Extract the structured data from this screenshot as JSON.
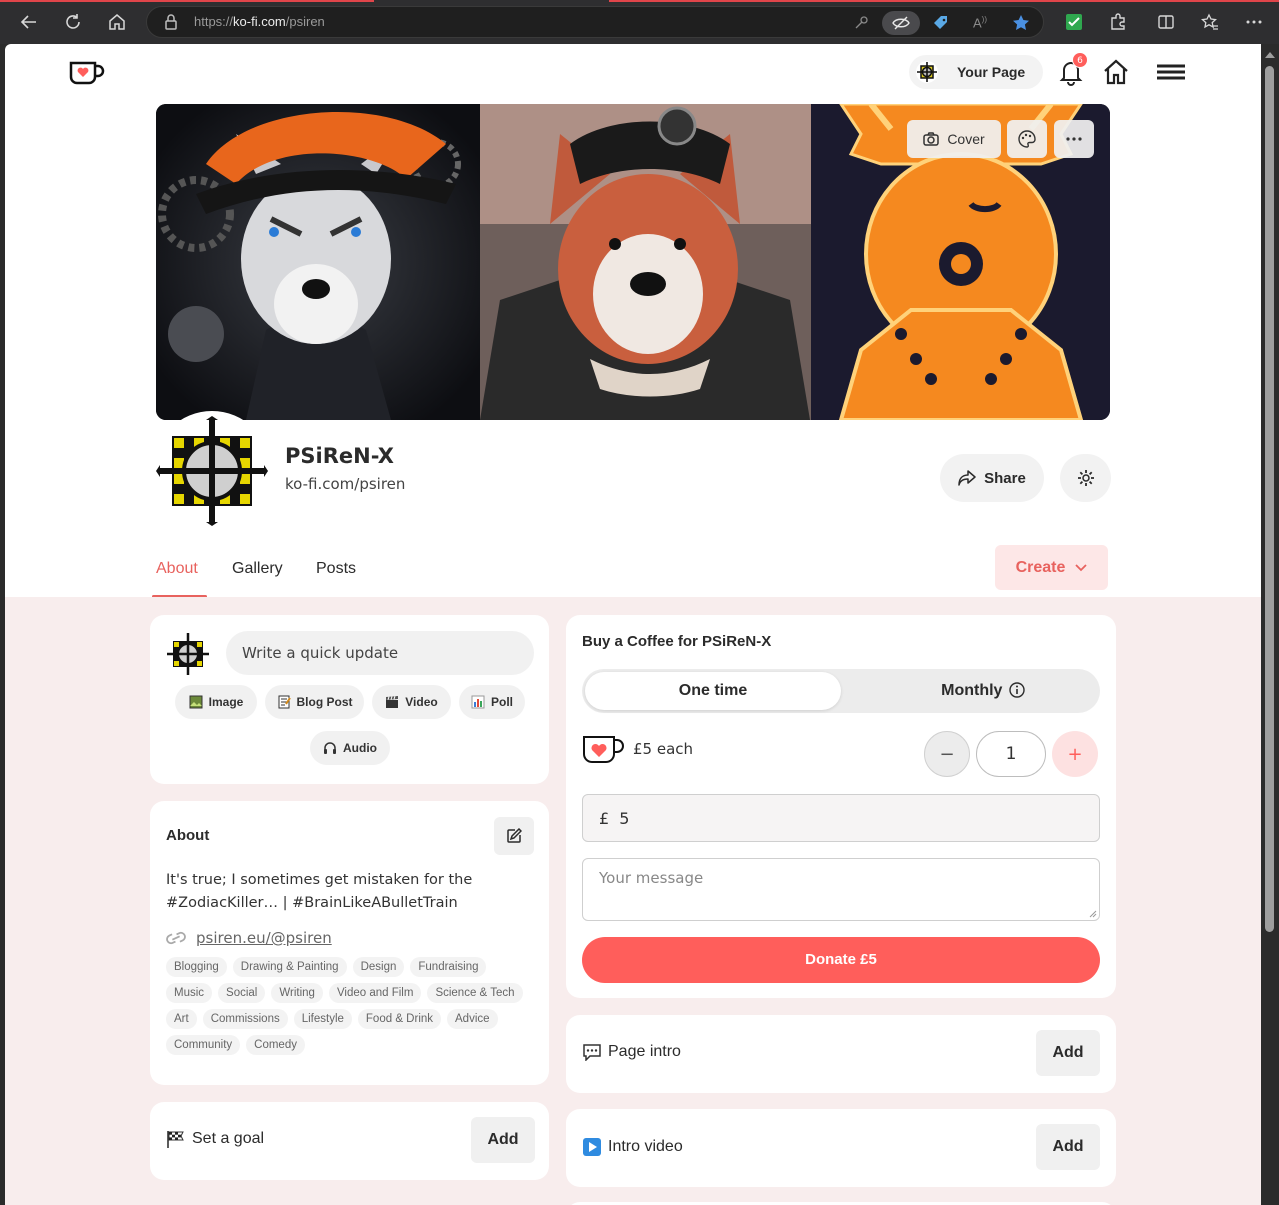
{
  "browser": {
    "url_prefix": "https://",
    "url_host": "ko-fi.com",
    "url_path": "/psiren"
  },
  "nav": {
    "your_page_label": "Your Page",
    "notification_count": "6"
  },
  "cover": {
    "cover_button_label": "Cover"
  },
  "profile": {
    "name": "PSiReN-X",
    "url": "ko-fi.com/psiren",
    "share_label": "Share"
  },
  "tabs": {
    "about": "About",
    "gallery": "Gallery",
    "posts": "Posts",
    "create_label": "Create"
  },
  "composer": {
    "placeholder": "Write a quick update",
    "actions": [
      "Image",
      "Blog Post",
      "Video",
      "Poll",
      "Audio"
    ]
  },
  "about": {
    "title": "About",
    "text": "It's true; I sometimes get mistaken for the #ZodiacKiller… | #BrainLikeABulletTrain",
    "link": "psiren.eu/@psiren",
    "tags": [
      "Blogging",
      "Drawing & Painting",
      "Design",
      "Fundraising",
      "Music",
      "Social",
      "Writing",
      "Video and Film",
      "Science & Tech",
      "Art",
      "Commissions",
      "Lifestyle",
      "Food & Drink",
      "Advice",
      "Community",
      "Comedy"
    ]
  },
  "goal": {
    "label": "Set a goal",
    "add_label": "Add"
  },
  "coffee": {
    "title": "Buy a Coffee for PSiReN-X",
    "one_time": "One time",
    "monthly": "Monthly",
    "price_each": "£5 each",
    "minus": "−",
    "quantity": "1",
    "plus": "+",
    "currency": "£",
    "amount": "5",
    "message_placeholder": "Your message",
    "donate_label": "Donate £5"
  },
  "page_intro": {
    "label": "Page intro",
    "add_label": "Add"
  },
  "intro_video": {
    "label": "Intro video",
    "add_label": "Add"
  },
  "colors": {
    "accent": "#ff5e5b",
    "accent_text": "#e8625e",
    "body_bg": "#f8eded"
  }
}
